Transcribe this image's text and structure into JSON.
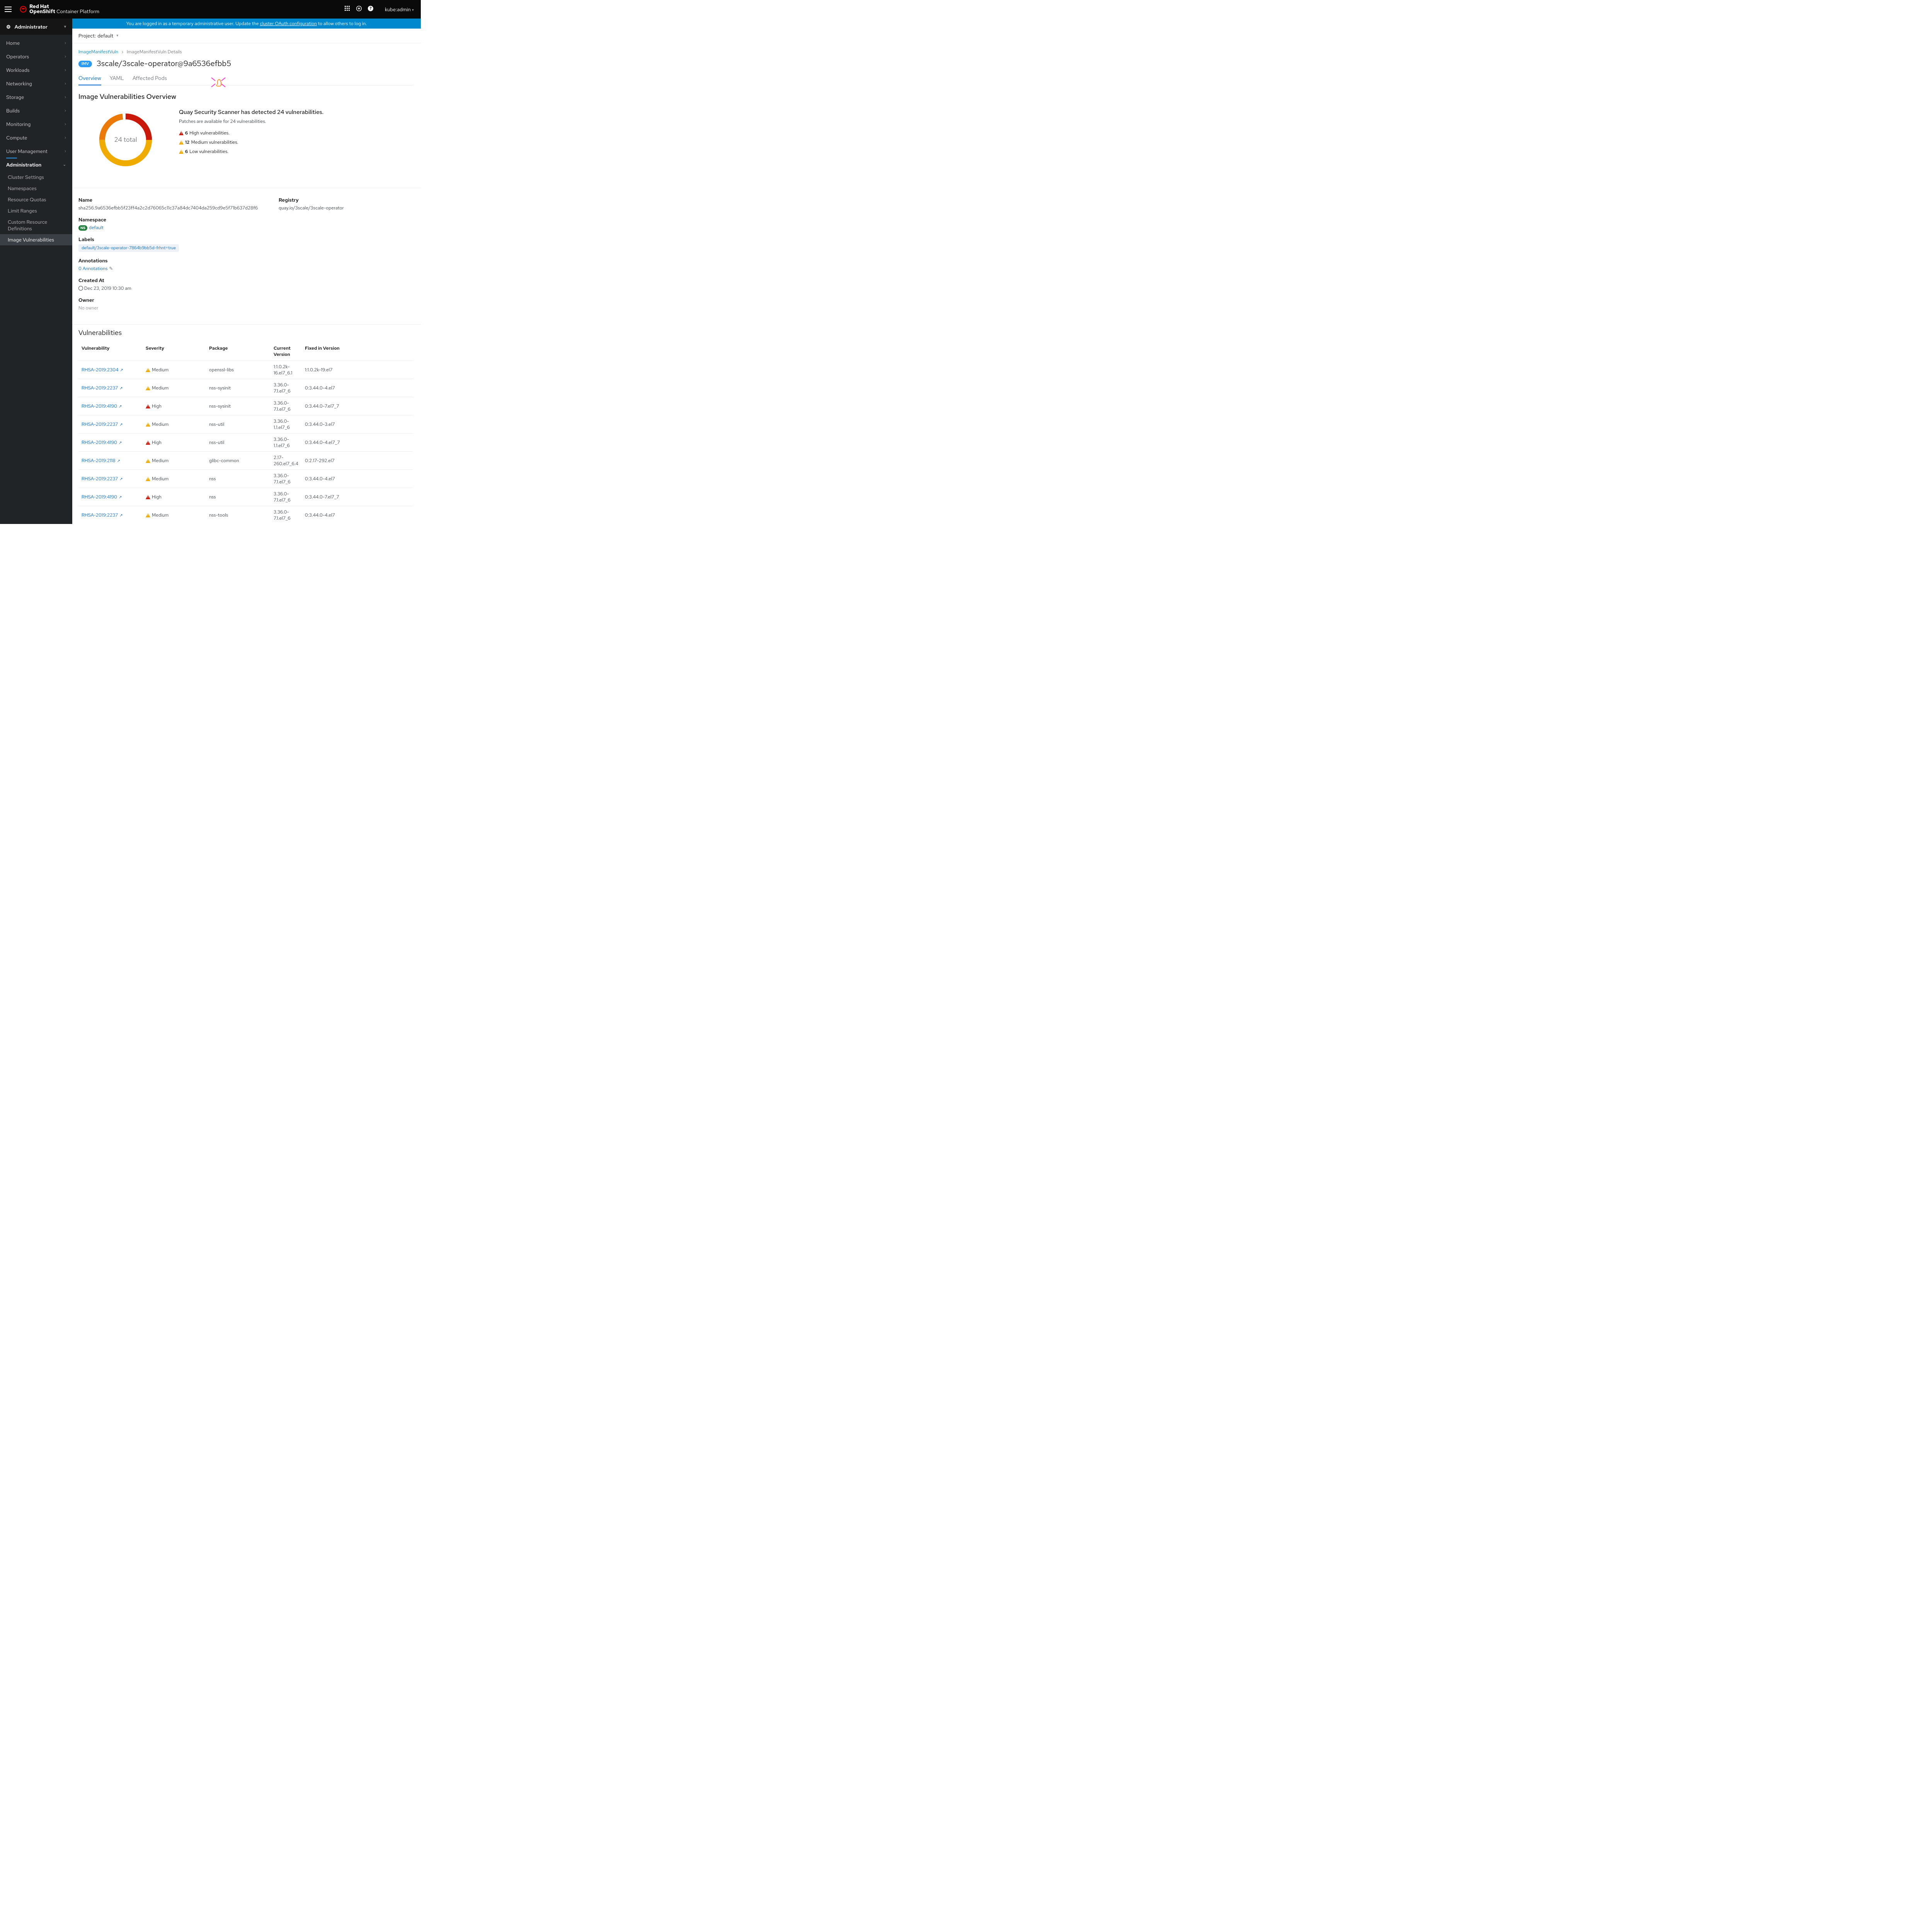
{
  "brand": {
    "strong": "Red Hat",
    "prod": "OpenShift",
    "suffix": " Container Platform"
  },
  "user": "kube:admin",
  "banner": {
    "pre": "You are logged in as a temporary administrative user. Update the ",
    "link": "cluster OAuth configuration",
    "post": " to allow others to log in."
  },
  "perspective": "Administrator",
  "nav": {
    "items": [
      "Home",
      "Operators",
      "Workloads",
      "Networking",
      "Storage",
      "Builds",
      "Monitoring",
      "Compute",
      "User Management",
      "Administration"
    ],
    "admin_sub": [
      "Cluster Settings",
      "Namespaces",
      "Resource Quotas",
      "Limit Ranges",
      "Custom Resource Definitions",
      "Image Vulnerabilities"
    ]
  },
  "project": {
    "label": "Project:",
    "value": "default"
  },
  "breadcrumb": {
    "root": "ImageManifestVuln",
    "sep": "›",
    "current": "ImageManifestVuln Details"
  },
  "page": {
    "badge": "IMV",
    "title": "3scale/3scale-operator@9a6536efbb5"
  },
  "tabs": [
    "Overview",
    "YAML",
    "Affected Pods"
  ],
  "overview_heading": "Image Vulnerabilities Overview",
  "chart_data": {
    "type": "pie",
    "title": "24 total",
    "categories": [
      "High",
      "Medium",
      "Low"
    ],
    "values": [
      6,
      12,
      6
    ],
    "colors": [
      "#c9190b",
      "#f0ab00",
      "#ec7a08"
    ]
  },
  "scan": {
    "title": "Quay Security Scanner has detected 24 vulnerabilities.",
    "patches": "Patches are available for 24 vulnerabilities.",
    "rows": [
      {
        "sev": "high",
        "count": "6",
        "label": " High vulnerabilities."
      },
      {
        "sev": "med",
        "count": "12",
        "label": " Medium vulnerabilities."
      },
      {
        "sev": "low",
        "count": "6",
        "label": " Low vulnerabilities."
      }
    ]
  },
  "details": {
    "name_label": "Name",
    "name": "sha256.9a6536efbb5f23ff4a2c2d76065c11c37a84dc7404da259cd9e5f71b637d28f6",
    "ns_label": "Namespace",
    "ns_badge": "NS",
    "ns": "default",
    "labels_label": "Labels",
    "label_chip": "default/3scale-operator-7864b9bb5d-frhnt=true",
    "anno_label": "Annotations",
    "anno": "0 Annotations",
    "created_label": "Created At",
    "created": "Dec 23, 2019 10:30 am",
    "owner_label": "Owner",
    "owner": "No owner",
    "registry_label": "Registry",
    "registry": "quay.io/3scale/3scale-operator"
  },
  "vuln_section": {
    "title": "Vulnerabilities",
    "headers": [
      "Vulnerability",
      "Severity",
      "Package",
      "Current Version",
      "Fixed in Version"
    ],
    "rows": [
      {
        "id": "RHSA-2019:2304",
        "sev": "Medium",
        "sevcls": "med",
        "pkg": "openssl-libs",
        "cur": "1:1.0.2k-16.el7_6.1",
        "fix": "1:1.0.2k-19.el7"
      },
      {
        "id": "RHSA-2019:2237",
        "sev": "Medium",
        "sevcls": "med",
        "pkg": "nss-sysinit",
        "cur": "3.36.0-7.1.el7_6",
        "fix": "0:3.44.0-4.el7"
      },
      {
        "id": "RHSA-2019:4190",
        "sev": "High",
        "sevcls": "high",
        "pkg": "nss-sysinit",
        "cur": "3.36.0-7.1.el7_6",
        "fix": "0:3.44.0-7.el7_7"
      },
      {
        "id": "RHSA-2019:2237",
        "sev": "Medium",
        "sevcls": "med",
        "pkg": "nss-util",
        "cur": "3.36.0-1.1.el7_6",
        "fix": "0:3.44.0-3.el7"
      },
      {
        "id": "RHSA-2019:4190",
        "sev": "High",
        "sevcls": "high",
        "pkg": "nss-util",
        "cur": "3.36.0-1.1.el7_6",
        "fix": "0:3.44.0-4.el7_7"
      },
      {
        "id": "RHSA-2019:2118",
        "sev": "Medium",
        "sevcls": "med",
        "pkg": "glibc-common",
        "cur": "2.17-260.el7_6.4",
        "fix": "0:2.17-292.el7"
      },
      {
        "id": "RHSA-2019:2237",
        "sev": "Medium",
        "sevcls": "med",
        "pkg": "nss",
        "cur": "3.36.0-7.1.el7_6",
        "fix": "0:3.44.0-4.el7"
      },
      {
        "id": "RHSA-2019:4190",
        "sev": "High",
        "sevcls": "high",
        "pkg": "nss",
        "cur": "3.36.0-7.1.el7_6",
        "fix": "0:3.44.0-7.el7_7"
      },
      {
        "id": "RHSA-2019:2237",
        "sev": "Medium",
        "sevcls": "med",
        "pkg": "nss-tools",
        "cur": "3.36.0-7.1.el7_6",
        "fix": "0:3.44.0-4.el7"
      }
    ]
  }
}
